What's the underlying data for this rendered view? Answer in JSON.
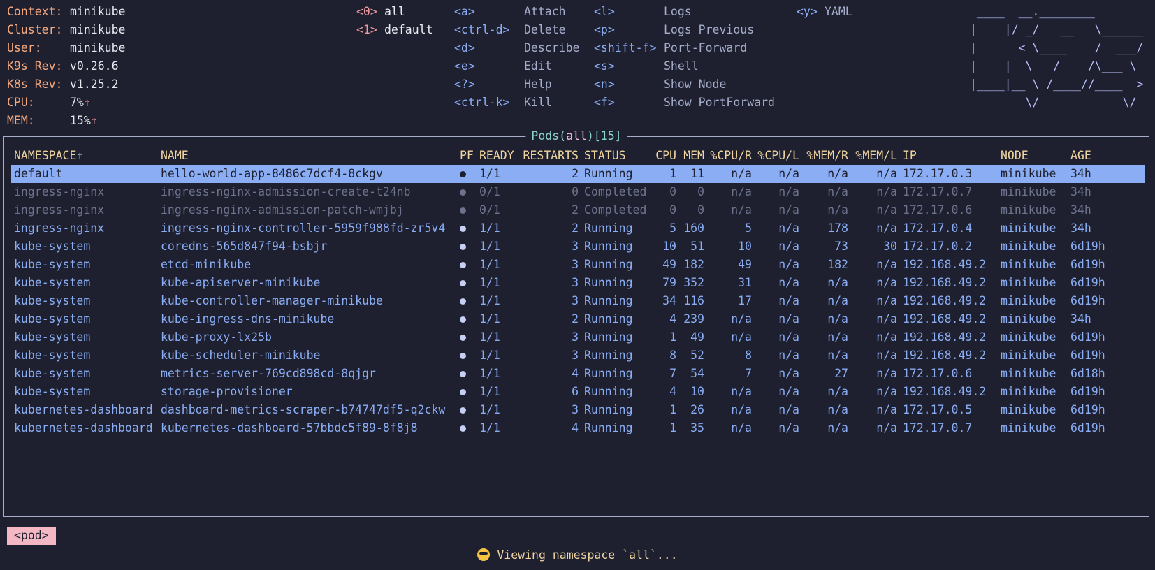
{
  "context": [
    {
      "key": "Context:",
      "value": "minikube"
    },
    {
      "key": "Cluster:",
      "value": "minikube"
    },
    {
      "key": "User:",
      "value": "minikube"
    },
    {
      "key": "K9s Rev:",
      "value": "v0.26.6"
    },
    {
      "key": "K8s Rev:",
      "value": "v1.25.2"
    },
    {
      "key": "CPU:",
      "value": "7%",
      "arrow": "↑"
    },
    {
      "key": "MEM:",
      "value": "15%",
      "arrow": "↑"
    }
  ],
  "namespaces": [
    {
      "key": "<0>",
      "label": "all"
    },
    {
      "key": "<1>",
      "label": "default"
    }
  ],
  "keybindings_col1": [
    {
      "key": "<a>",
      "label": "Attach"
    },
    {
      "key": "<ctrl-d>",
      "label": "Delete"
    },
    {
      "key": "<d>",
      "label": "Describe"
    },
    {
      "key": "<e>",
      "label": "Edit"
    },
    {
      "key": "<?>",
      "label": "Help"
    },
    {
      "key": "<ctrl-k>",
      "label": "Kill"
    }
  ],
  "keybindings_col2": [
    {
      "key": "<l>",
      "label": "Logs"
    },
    {
      "key": "<p>",
      "label": "Logs Previous"
    },
    {
      "key": "<shift-f>",
      "label": "Port-Forward"
    },
    {
      "key": "<s>",
      "label": "Shell"
    },
    {
      "key": "<n>",
      "label": "Show Node"
    },
    {
      "key": "<f>",
      "label": "Show PortForward"
    }
  ],
  "keybindings_col3": [
    {
      "key": "<y>",
      "label": "YAML"
    }
  ],
  "logo_lines": [
    " ____  __.________       ",
    "|    |/ _/   __   \\______",
    "|      < \\____    /  ___/",
    "|    |  \\   /    /\\___ \\ ",
    "|____|__ \\ /____//____  >",
    "        \\/            \\/ "
  ],
  "table_title": {
    "resource": "Pods",
    "namespace": "all",
    "count": "15"
  },
  "columns": [
    "NAMESPACE",
    "NAME",
    "PF",
    "READY",
    "RESTARTS",
    "STATUS",
    "CPU",
    "MEM",
    "%CPU/R",
    "%CPU/L",
    "%MEM/R",
    "%MEM/L",
    "IP",
    "NODE",
    "AGE"
  ],
  "sort_indicator": "↑",
  "rows": [
    [
      "default",
      "hello-world-app-8486c7dcf4-8ckgv",
      "",
      "1/1",
      "2",
      "Running",
      "1",
      "11",
      "n/a",
      "n/a",
      "n/a",
      "n/a",
      "172.17.0.3",
      "minikube",
      "34h"
    ],
    [
      "ingress-nginx",
      "ingress-nginx-admission-create-t24nb",
      "",
      "0/1",
      "0",
      "Completed",
      "0",
      "0",
      "n/a",
      "n/a",
      "n/a",
      "n/a",
      "172.17.0.7",
      "minikube",
      "34h"
    ],
    [
      "ingress-nginx",
      "ingress-nginx-admission-patch-wmjbj",
      "",
      "0/1",
      "2",
      "Completed",
      "0",
      "0",
      "n/a",
      "n/a",
      "n/a",
      "n/a",
      "172.17.0.6",
      "minikube",
      "34h"
    ],
    [
      "ingress-nginx",
      "ingress-nginx-controller-5959f988fd-zr5v4",
      "",
      "1/1",
      "2",
      "Running",
      "5",
      "160",
      "5",
      "n/a",
      "178",
      "n/a",
      "172.17.0.4",
      "minikube",
      "34h"
    ],
    [
      "kube-system",
      "coredns-565d847f94-bsbjr",
      "",
      "1/1",
      "3",
      "Running",
      "10",
      "51",
      "10",
      "n/a",
      "73",
      "30",
      "172.17.0.2",
      "minikube",
      "6d19h"
    ],
    [
      "kube-system",
      "etcd-minikube",
      "",
      "1/1",
      "3",
      "Running",
      "49",
      "182",
      "49",
      "n/a",
      "182",
      "n/a",
      "192.168.49.2",
      "minikube",
      "6d19h"
    ],
    [
      "kube-system",
      "kube-apiserver-minikube",
      "",
      "1/1",
      "3",
      "Running",
      "79",
      "352",
      "31",
      "n/a",
      "n/a",
      "n/a",
      "192.168.49.2",
      "minikube",
      "6d19h"
    ],
    [
      "kube-system",
      "kube-controller-manager-minikube",
      "",
      "1/1",
      "3",
      "Running",
      "34",
      "116",
      "17",
      "n/a",
      "n/a",
      "n/a",
      "192.168.49.2",
      "minikube",
      "6d19h"
    ],
    [
      "kube-system",
      "kube-ingress-dns-minikube",
      "",
      "1/1",
      "2",
      "Running",
      "4",
      "239",
      "n/a",
      "n/a",
      "n/a",
      "n/a",
      "192.168.49.2",
      "minikube",
      "34h"
    ],
    [
      "kube-system",
      "kube-proxy-lx25b",
      "",
      "1/1",
      "3",
      "Running",
      "1",
      "49",
      "n/a",
      "n/a",
      "n/a",
      "n/a",
      "192.168.49.2",
      "minikube",
      "6d19h"
    ],
    [
      "kube-system",
      "kube-scheduler-minikube",
      "",
      "1/1",
      "3",
      "Running",
      "8",
      "52",
      "8",
      "n/a",
      "n/a",
      "n/a",
      "192.168.49.2",
      "minikube",
      "6d19h"
    ],
    [
      "kube-system",
      "metrics-server-769cd898cd-8qjgr",
      "",
      "1/1",
      "4",
      "Running",
      "7",
      "54",
      "7",
      "n/a",
      "27",
      "n/a",
      "172.17.0.6",
      "minikube",
      "6d18h"
    ],
    [
      "kube-system",
      "storage-provisioner",
      "",
      "1/1",
      "6",
      "Running",
      "4",
      "10",
      "n/a",
      "n/a",
      "n/a",
      "n/a",
      "192.168.49.2",
      "minikube",
      "6d19h"
    ],
    [
      "kubernetes-dashboard",
      "dashboard-metrics-scraper-b74747df5-q2ckw",
      "",
      "1/1",
      "3",
      "Running",
      "1",
      "26",
      "n/a",
      "n/a",
      "n/a",
      "n/a",
      "172.17.0.5",
      "minikube",
      "6d19h"
    ],
    [
      "kubernetes-dashboard",
      "kubernetes-dashboard-57bbdc5f89-8f8j8",
      "",
      "1/1",
      "4",
      "Running",
      "1",
      "35",
      "n/a",
      "n/a",
      "n/a",
      "n/a",
      "172.17.0.7",
      "minikube",
      "6d19h"
    ]
  ],
  "breadcrumb": "<pod>",
  "status_message": "Viewing namespace `all`..."
}
